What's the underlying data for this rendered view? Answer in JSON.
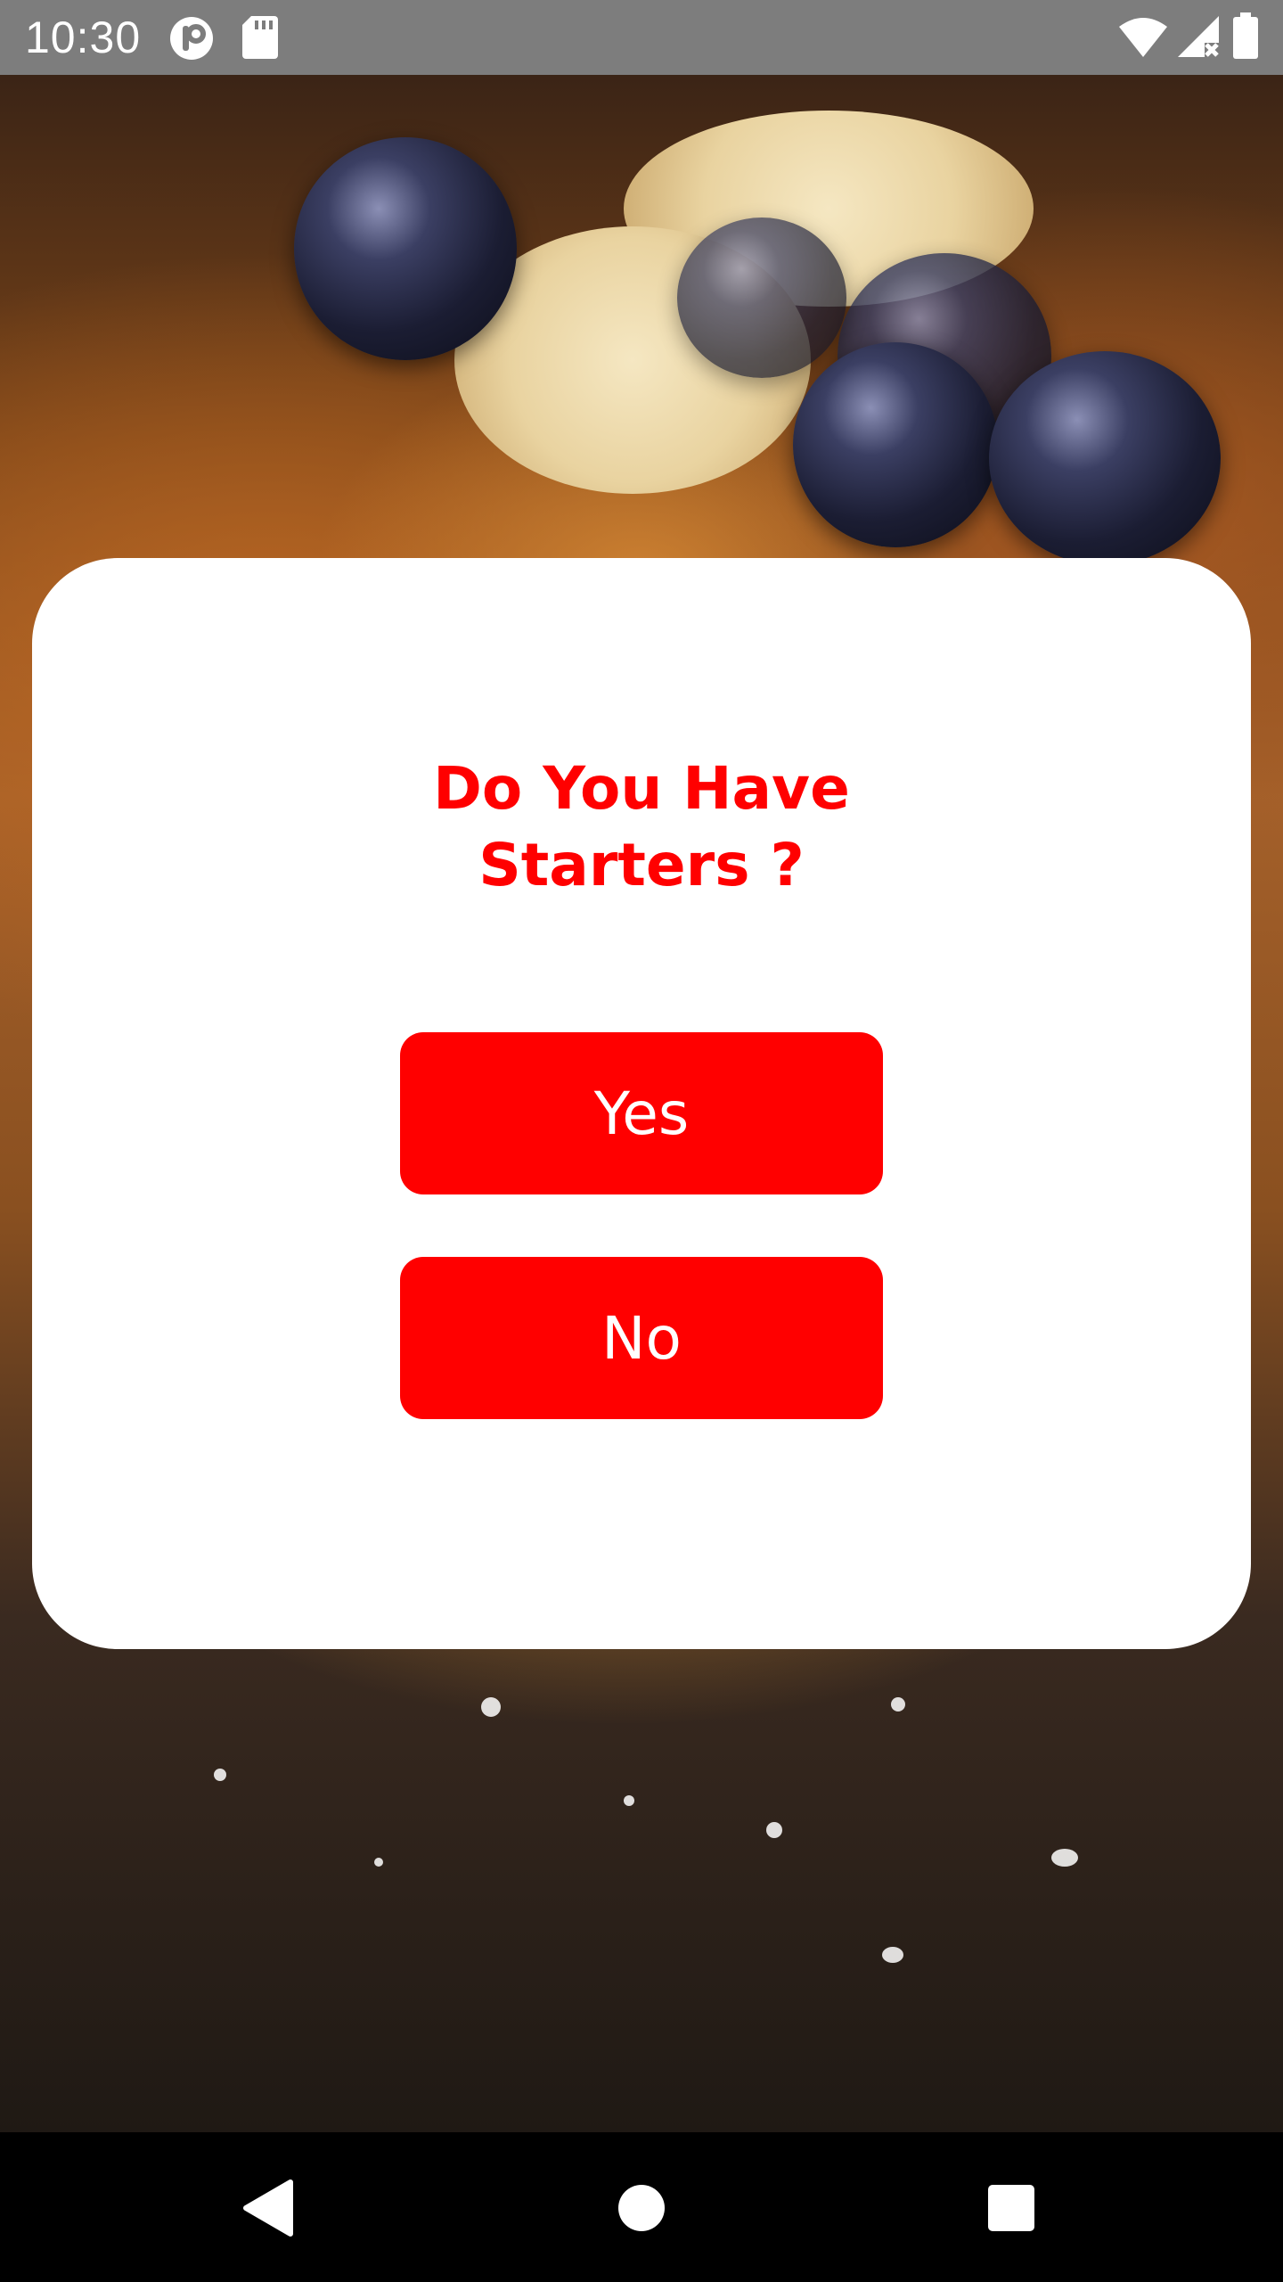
{
  "status_bar": {
    "time": "10:30",
    "icons": [
      "app-notification-icon",
      "sd-card-icon",
      "wifi-icon",
      "cellular-no-data-icon",
      "battery-icon"
    ]
  },
  "background": {
    "description_icon": "food-photo"
  },
  "dialog": {
    "title": "Do You Have\nStarters ?",
    "yes_label": "Yes",
    "no_label": "No",
    "accent_color": "#ff0000"
  },
  "nav_bar": {
    "icons": [
      "back-icon",
      "home-icon",
      "recents-icon"
    ]
  }
}
